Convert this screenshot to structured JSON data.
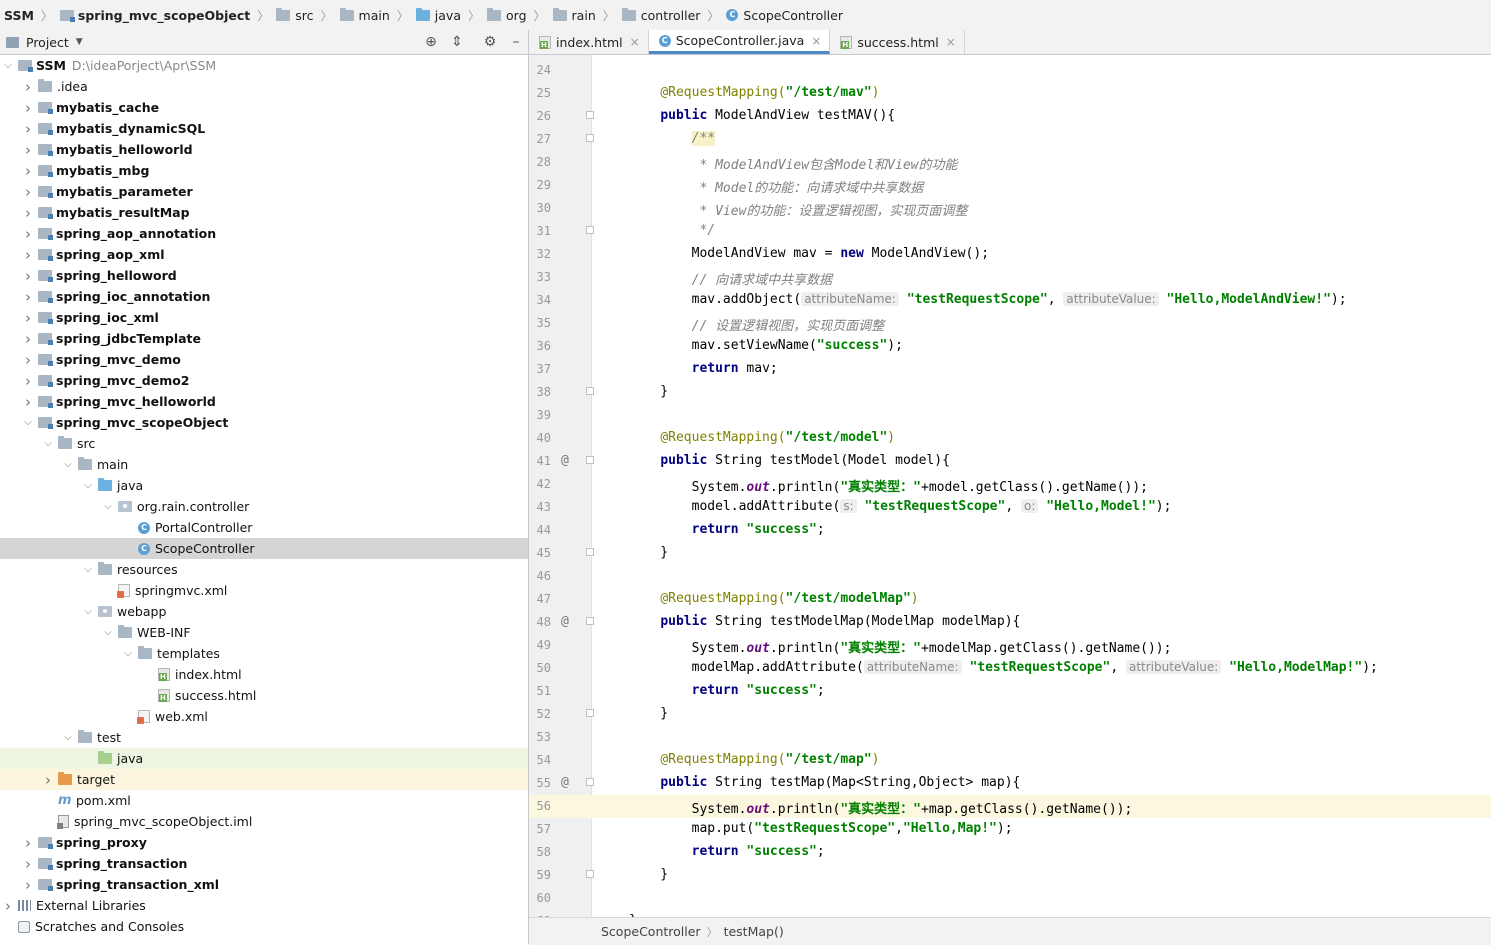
{
  "breadcrumb": [
    {
      "label": "SSM",
      "icon": "none",
      "bold": true
    },
    {
      "label": "spring_mvc_scopeObject",
      "icon": "module-icon",
      "bold": true
    },
    {
      "label": "src",
      "icon": "folder-icon",
      "bold": false
    },
    {
      "label": "main",
      "icon": "folder-icon",
      "bold": false
    },
    {
      "label": "java",
      "icon": "source-folder-icon",
      "bold": false
    },
    {
      "label": "org",
      "icon": "folder-icon",
      "bold": false
    },
    {
      "label": "rain",
      "icon": "folder-icon",
      "bold": false
    },
    {
      "label": "controller",
      "icon": "folder-icon",
      "bold": false
    },
    {
      "label": "ScopeController",
      "icon": "class-icon",
      "bold": false
    }
  ],
  "project_panel": {
    "title": "Project"
  },
  "tree": [
    {
      "label": "SSM",
      "path": "D:\\ideaPorject\\Apr\\SSM",
      "depth": 0,
      "arrow": "down",
      "icon": "module",
      "bold": true
    },
    {
      "label": ".idea",
      "depth": 1,
      "arrow": "right",
      "icon": "folder",
      "bold": false
    },
    {
      "label": "mybatis_cache",
      "depth": 1,
      "arrow": "right",
      "icon": "module",
      "bold": true
    },
    {
      "label": "mybatis_dynamicSQL",
      "depth": 1,
      "arrow": "right",
      "icon": "module",
      "bold": true
    },
    {
      "label": "mybatis_helloworld",
      "depth": 1,
      "arrow": "right",
      "icon": "module",
      "bold": true
    },
    {
      "label": "mybatis_mbg",
      "depth": 1,
      "arrow": "right",
      "icon": "module",
      "bold": true
    },
    {
      "label": "mybatis_parameter",
      "depth": 1,
      "arrow": "right",
      "icon": "module",
      "bold": true
    },
    {
      "label": "mybatis_resultMap",
      "depth": 1,
      "arrow": "right",
      "icon": "module",
      "bold": true
    },
    {
      "label": "spring_aop_annotation",
      "depth": 1,
      "arrow": "right",
      "icon": "module",
      "bold": true
    },
    {
      "label": "spring_aop_xml",
      "depth": 1,
      "arrow": "right",
      "icon": "module",
      "bold": true
    },
    {
      "label": "spring_helloword",
      "depth": 1,
      "arrow": "right",
      "icon": "module",
      "bold": true
    },
    {
      "label": "spring_ioc_annotation",
      "depth": 1,
      "arrow": "right",
      "icon": "module",
      "bold": true
    },
    {
      "label": "spring_ioc_xml",
      "depth": 1,
      "arrow": "right",
      "icon": "module",
      "bold": true
    },
    {
      "label": "spring_jdbcTemplate",
      "depth": 1,
      "arrow": "right",
      "icon": "module",
      "bold": true
    },
    {
      "label": "spring_mvc_demo",
      "depth": 1,
      "arrow": "right",
      "icon": "module",
      "bold": true
    },
    {
      "label": "spring_mvc_demo2",
      "depth": 1,
      "arrow": "right",
      "icon": "module",
      "bold": true
    },
    {
      "label": "spring_mvc_helloworld",
      "depth": 1,
      "arrow": "right",
      "icon": "module",
      "bold": true
    },
    {
      "label": "spring_mvc_scopeObject",
      "depth": 1,
      "arrow": "down",
      "icon": "module",
      "bold": true
    },
    {
      "label": "src",
      "depth": 2,
      "arrow": "down",
      "icon": "folder",
      "bold": false
    },
    {
      "label": "main",
      "depth": 3,
      "arrow": "down",
      "icon": "folder",
      "bold": false
    },
    {
      "label": "java",
      "depth": 4,
      "arrow": "down",
      "icon": "source",
      "bold": false
    },
    {
      "label": "org.rain.controller",
      "depth": 5,
      "arrow": "down",
      "icon": "package",
      "bold": false
    },
    {
      "label": "PortalController",
      "depth": 6,
      "arrow": "none",
      "icon": "class",
      "bold": false
    },
    {
      "label": "ScopeController",
      "depth": 6,
      "arrow": "none",
      "icon": "class",
      "bold": false,
      "selected": true
    },
    {
      "label": "resources",
      "depth": 4,
      "arrow": "down",
      "icon": "resources",
      "bold": false
    },
    {
      "label": "springmvc.xml",
      "depth": 5,
      "arrow": "none",
      "icon": "xml",
      "bold": false
    },
    {
      "label": "webapp",
      "depth": 4,
      "arrow": "down",
      "icon": "webfolder",
      "bold": false
    },
    {
      "label": "WEB-INF",
      "depth": 5,
      "arrow": "down",
      "icon": "folder",
      "bold": false
    },
    {
      "label": "templates",
      "depth": 6,
      "arrow": "down",
      "icon": "folder",
      "bold": false
    },
    {
      "label": "index.html",
      "depth": 7,
      "arrow": "none",
      "icon": "html",
      "bold": false
    },
    {
      "label": "success.html",
      "depth": 7,
      "arrow": "none",
      "icon": "html",
      "bold": false
    },
    {
      "label": "web.xml",
      "depth": 6,
      "arrow": "none",
      "icon": "xml",
      "bold": false
    },
    {
      "label": "test",
      "depth": 3,
      "arrow": "down",
      "icon": "folder",
      "bold": false
    },
    {
      "label": "java",
      "depth": 4,
      "arrow": "none",
      "icon": "testsource",
      "bold": false,
      "highlight": "green"
    },
    {
      "label": "target",
      "depth": 2,
      "arrow": "right",
      "icon": "target",
      "bold": false,
      "highlight": "yellow"
    },
    {
      "label": "pom.xml",
      "depth": 2,
      "arrow": "none",
      "icon": "pom",
      "bold": false
    },
    {
      "label": "spring_mvc_scopeObject.iml",
      "depth": 2,
      "arrow": "none",
      "icon": "iml",
      "bold": false
    },
    {
      "label": "spring_proxy",
      "depth": 1,
      "arrow": "right",
      "icon": "module",
      "bold": true
    },
    {
      "label": "spring_transaction",
      "depth": 1,
      "arrow": "right",
      "icon": "module",
      "bold": true
    },
    {
      "label": "spring_transaction_xml",
      "depth": 1,
      "arrow": "right",
      "icon": "module",
      "bold": true
    },
    {
      "label": "External Libraries",
      "depth": 0,
      "arrow": "right",
      "icon": "library",
      "bold": false
    },
    {
      "label": "Scratches and Consoles",
      "depth": 0,
      "arrow": "none",
      "icon": "scratch",
      "bold": false
    }
  ],
  "tabs": [
    {
      "label": "index.html",
      "icon": "html-file-icon",
      "active": false
    },
    {
      "label": "ScopeController.java",
      "icon": "class-icon",
      "active": true
    },
    {
      "label": "success.html",
      "icon": "html-file-icon",
      "active": false
    }
  ],
  "tab_close_glyph": "×",
  "editor_breadcrumb": [
    "ScopeController",
    "testMap()"
  ],
  "code_lines": [
    {
      "n": "24",
      "mark": "",
      "fold": false,
      "tokens": []
    },
    {
      "n": "25",
      "mark": "",
      "fold": false,
      "tokens": [
        {
          "t": "    "
        },
        {
          "t": "@RequestMapping(",
          "c": "ann"
        },
        {
          "t": "\"/test/mav\"",
          "c": "str"
        },
        {
          "t": ")",
          "c": "ann"
        }
      ]
    },
    {
      "n": "26",
      "mark": "",
      "fold": true,
      "tokens": [
        {
          "t": "    "
        },
        {
          "t": "public",
          "c": "kw"
        },
        {
          "t": " ModelAndView testMAV(){"
        }
      ]
    },
    {
      "n": "27",
      "mark": "",
      "fold": true,
      "tokens": [
        {
          "t": "        "
        },
        {
          "t": "/**",
          "c": "doc"
        }
      ]
    },
    {
      "n": "28",
      "mark": "",
      "fold": false,
      "tokens": [
        {
          "t": "         "
        },
        {
          "t": "* ModelAndView包含Model和View的功能",
          "c": "cmt"
        }
      ]
    },
    {
      "n": "29",
      "mark": "",
      "fold": false,
      "tokens": [
        {
          "t": "         "
        },
        {
          "t": "* Model的功能：向请求域中共享数据",
          "c": "cmt"
        }
      ]
    },
    {
      "n": "30",
      "mark": "",
      "fold": false,
      "tokens": [
        {
          "t": "         "
        },
        {
          "t": "* View的功能：设置逻辑视图，实现页面调整",
          "c": "cmt"
        }
      ]
    },
    {
      "n": "31",
      "mark": "",
      "fold": true,
      "tokens": [
        {
          "t": "         "
        },
        {
          "t": "*/",
          "c": "cmt"
        }
      ]
    },
    {
      "n": "32",
      "mark": "",
      "fold": false,
      "tokens": [
        {
          "t": "        ModelAndView mav = "
        },
        {
          "t": "new",
          "c": "kw"
        },
        {
          "t": " ModelAndView();"
        }
      ]
    },
    {
      "n": "33",
      "mark": "",
      "fold": false,
      "tokens": [
        {
          "t": "        "
        },
        {
          "t": "// 向请求域中共享数据",
          "c": "lcmt"
        }
      ]
    },
    {
      "n": "34",
      "mark": "",
      "fold": false,
      "tokens": [
        {
          "t": "        mav.addObject("
        },
        {
          "t": "attributeName:",
          "c": "hint"
        },
        {
          "t": " "
        },
        {
          "t": "\"testRequestScope\"",
          "c": "str"
        },
        {
          "t": ", "
        },
        {
          "t": "attributeValue:",
          "c": "hint"
        },
        {
          "t": " "
        },
        {
          "t": "\"Hello,ModelAndView!\"",
          "c": "str"
        },
        {
          "t": ");"
        }
      ]
    },
    {
      "n": "35",
      "mark": "",
      "fold": false,
      "tokens": [
        {
          "t": "        "
        },
        {
          "t": "// 设置逻辑视图，实现页面调整",
          "c": "lcmt"
        }
      ]
    },
    {
      "n": "36",
      "mark": "",
      "fold": false,
      "tokens": [
        {
          "t": "        mav.setViewName("
        },
        {
          "t": "\"success\"",
          "c": "str"
        },
        {
          "t": ");"
        }
      ]
    },
    {
      "n": "37",
      "mark": "",
      "fold": false,
      "tokens": [
        {
          "t": "        "
        },
        {
          "t": "return",
          "c": "kw"
        },
        {
          "t": " mav;"
        }
      ]
    },
    {
      "n": "38",
      "mark": "",
      "fold": true,
      "tokens": [
        {
          "t": "    }"
        }
      ]
    },
    {
      "n": "39",
      "mark": "",
      "fold": false,
      "tokens": []
    },
    {
      "n": "40",
      "mark": "",
      "fold": false,
      "tokens": [
        {
          "t": "    "
        },
        {
          "t": "@RequestMapping(",
          "c": "ann"
        },
        {
          "t": "\"/test/model\"",
          "c": "str"
        },
        {
          "t": ")",
          "c": "ann"
        }
      ]
    },
    {
      "n": "41",
      "mark": "@",
      "fold": true,
      "tokens": [
        {
          "t": "    "
        },
        {
          "t": "public",
          "c": "kw"
        },
        {
          "t": " String testModel(Model model){"
        }
      ]
    },
    {
      "n": "42",
      "mark": "",
      "fold": false,
      "tokens": [
        {
          "t": "        System."
        },
        {
          "t": "out",
          "c": "fld"
        },
        {
          "t": ".println("
        },
        {
          "t": "\"真实类型：\"",
          "c": "str"
        },
        {
          "t": "+model.getClass().getName());"
        }
      ]
    },
    {
      "n": "43",
      "mark": "",
      "fold": false,
      "tokens": [
        {
          "t": "        model.addAttribute("
        },
        {
          "t": "s:",
          "c": "hint"
        },
        {
          "t": " "
        },
        {
          "t": "\"testRequestScope\"",
          "c": "str"
        },
        {
          "t": ", "
        },
        {
          "t": "o:",
          "c": "hint"
        },
        {
          "t": " "
        },
        {
          "t": "\"Hello,Model!\"",
          "c": "str"
        },
        {
          "t": ");"
        }
      ]
    },
    {
      "n": "44",
      "mark": "",
      "fold": false,
      "tokens": [
        {
          "t": "        "
        },
        {
          "t": "return",
          "c": "kw"
        },
        {
          "t": " "
        },
        {
          "t": "\"success\"",
          "c": "str"
        },
        {
          "t": ";"
        }
      ]
    },
    {
      "n": "45",
      "mark": "",
      "fold": true,
      "tokens": [
        {
          "t": "    }"
        }
      ]
    },
    {
      "n": "46",
      "mark": "",
      "fold": false,
      "tokens": []
    },
    {
      "n": "47",
      "mark": "",
      "fold": false,
      "tokens": [
        {
          "t": "    "
        },
        {
          "t": "@RequestMapping(",
          "c": "ann"
        },
        {
          "t": "\"/test/modelMap\"",
          "c": "str"
        },
        {
          "t": ")",
          "c": "ann"
        }
      ]
    },
    {
      "n": "48",
      "mark": "@",
      "fold": true,
      "tokens": [
        {
          "t": "    "
        },
        {
          "t": "public",
          "c": "kw"
        },
        {
          "t": " String testModelMap(ModelMap modelMap){"
        }
      ]
    },
    {
      "n": "49",
      "mark": "",
      "fold": false,
      "tokens": [
        {
          "t": "        System."
        },
        {
          "t": "out",
          "c": "fld"
        },
        {
          "t": ".println("
        },
        {
          "t": "\"真实类型：\"",
          "c": "str"
        },
        {
          "t": "+modelMap.getClass().getName());"
        }
      ]
    },
    {
      "n": "50",
      "mark": "",
      "fold": false,
      "tokens": [
        {
          "t": "        modelMap.addAttribute("
        },
        {
          "t": "attributeName:",
          "c": "hint"
        },
        {
          "t": " "
        },
        {
          "t": "\"testRequestScope\"",
          "c": "str"
        },
        {
          "t": ", "
        },
        {
          "t": "attributeValue:",
          "c": "hint"
        },
        {
          "t": " "
        },
        {
          "t": "\"Hello,ModelMap!\"",
          "c": "str"
        },
        {
          "t": ");"
        }
      ]
    },
    {
      "n": "51",
      "mark": "",
      "fold": false,
      "tokens": [
        {
          "t": "        "
        },
        {
          "t": "return",
          "c": "kw"
        },
        {
          "t": " "
        },
        {
          "t": "\"success\"",
          "c": "str"
        },
        {
          "t": ";"
        }
      ]
    },
    {
      "n": "52",
      "mark": "",
      "fold": true,
      "tokens": [
        {
          "t": "    }"
        }
      ]
    },
    {
      "n": "53",
      "mark": "",
      "fold": false,
      "tokens": []
    },
    {
      "n": "54",
      "mark": "",
      "fold": false,
      "tokens": [
        {
          "t": "    "
        },
        {
          "t": "@RequestMapping(",
          "c": "ann"
        },
        {
          "t": "\"/test/map\"",
          "c": "str"
        },
        {
          "t": ")",
          "c": "ann"
        }
      ]
    },
    {
      "n": "55",
      "mark": "@",
      "fold": true,
      "tokens": [
        {
          "t": "    "
        },
        {
          "t": "public",
          "c": "kw"
        },
        {
          "t": " String testMap(Map<String,Object> map){"
        }
      ]
    },
    {
      "n": "56",
      "mark": "",
      "fold": false,
      "current": true,
      "tokens": [
        {
          "t": "        System."
        },
        {
          "t": "out",
          "c": "fld"
        },
        {
          "t": ".println("
        },
        {
          "t": "\"真实类型：\"",
          "c": "str"
        },
        {
          "t": "+map.getClass().getName());"
        }
      ]
    },
    {
      "n": "57",
      "mark": "",
      "fold": false,
      "tokens": [
        {
          "t": "        map.put("
        },
        {
          "t": "\"testRequestScope\"",
          "c": "str"
        },
        {
          "t": ","
        },
        {
          "t": "\"Hello,Map!\"",
          "c": "str"
        },
        {
          "t": ");"
        }
      ]
    },
    {
      "n": "58",
      "mark": "",
      "fold": false,
      "tokens": [
        {
          "t": "        "
        },
        {
          "t": "return",
          "c": "kw"
        },
        {
          "t": " "
        },
        {
          "t": "\"success\"",
          "c": "str"
        },
        {
          "t": ";"
        }
      ]
    },
    {
      "n": "59",
      "mark": "",
      "fold": true,
      "tokens": [
        {
          "t": "    }"
        }
      ]
    },
    {
      "n": "60",
      "mark": "",
      "fold": false,
      "tokens": []
    },
    {
      "n": "61",
      "mark": "",
      "fold": false,
      "tokens": [
        {
          "t": "}"
        }
      ]
    }
  ]
}
